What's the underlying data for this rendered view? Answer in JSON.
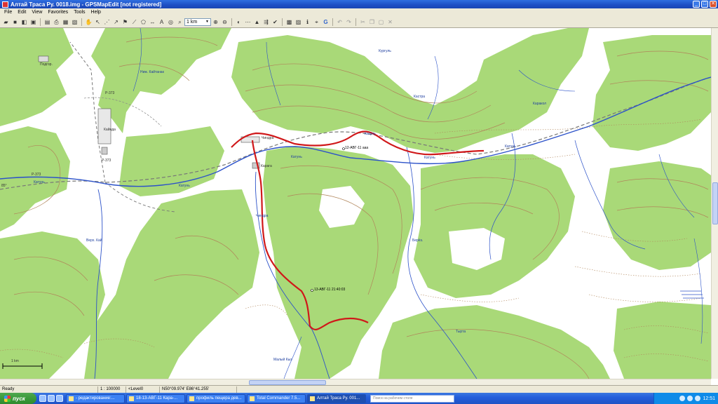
{
  "window": {
    "title": "Алтай Траса Ру. 0018.img - GPSMapEdit [not registered]",
    "btn_min": "_",
    "btn_max": "□",
    "btn_close": "✕"
  },
  "menu": [
    "File",
    "Edit",
    "View",
    "Favorites",
    "Tools",
    "Help"
  ],
  "toolbar": {
    "scale_value": "1 km",
    "scale_arrow": "▼"
  },
  "map": {
    "labels": {
      "podgor": "Подгор.",
      "kaynda": "Кайнда",
      "chindra": "Чиндра",
      "karagay": "Карага",
      "r373a": "Р-373",
      "r373b": "Р-373",
      "r373c": "Р-373",
      "scale_bar": "1 km",
      "lon_mark": "85°"
    },
    "rivers": {
      "katun1": "Катунь",
      "katun2": "Катунь",
      "katun3": "Катунь",
      "katun4": "Катунь",
      "katun5": "Катунь",
      "katun6": "Катунь",
      "kurgul": "Кургуль",
      "chindra_r": "Чиндра",
      "k_tok": "Каракол",
      "kostr": "Кастра",
      "n_kayt": "Ниж. Кайтанак",
      "bey": "Берёз.",
      "tyrta": "Тырта",
      "malaya": "Малый Кыз",
      "verkh": "Верх. Кай"
    },
    "track_labels": {
      "t1": "12-АВГ-11 ааа",
      "t2": "13-АВГ-11 21:40:03"
    }
  },
  "status": {
    "ready": "Ready",
    "scale": "1 : 100000",
    "level": "<Level0",
    "coords": "N50°09.974' E86°41.255'"
  },
  "taskbar": {
    "start": "пуск",
    "tasks": [
      "- редактирование:...",
      "18-13-АВГ-11 Кара-...",
      "профиль пещера дев...",
      "Total Commander 7.5...",
      "Алтай Траса Ру. 001..."
    ],
    "search_placeholder": "Поиск на рабочем столе",
    "clock": "12:51"
  },
  "colors": {
    "forest": "#a9d978",
    "contour": "#b0855a",
    "river": "#2c52c9",
    "track": "#d0181a",
    "road": "#666666"
  }
}
